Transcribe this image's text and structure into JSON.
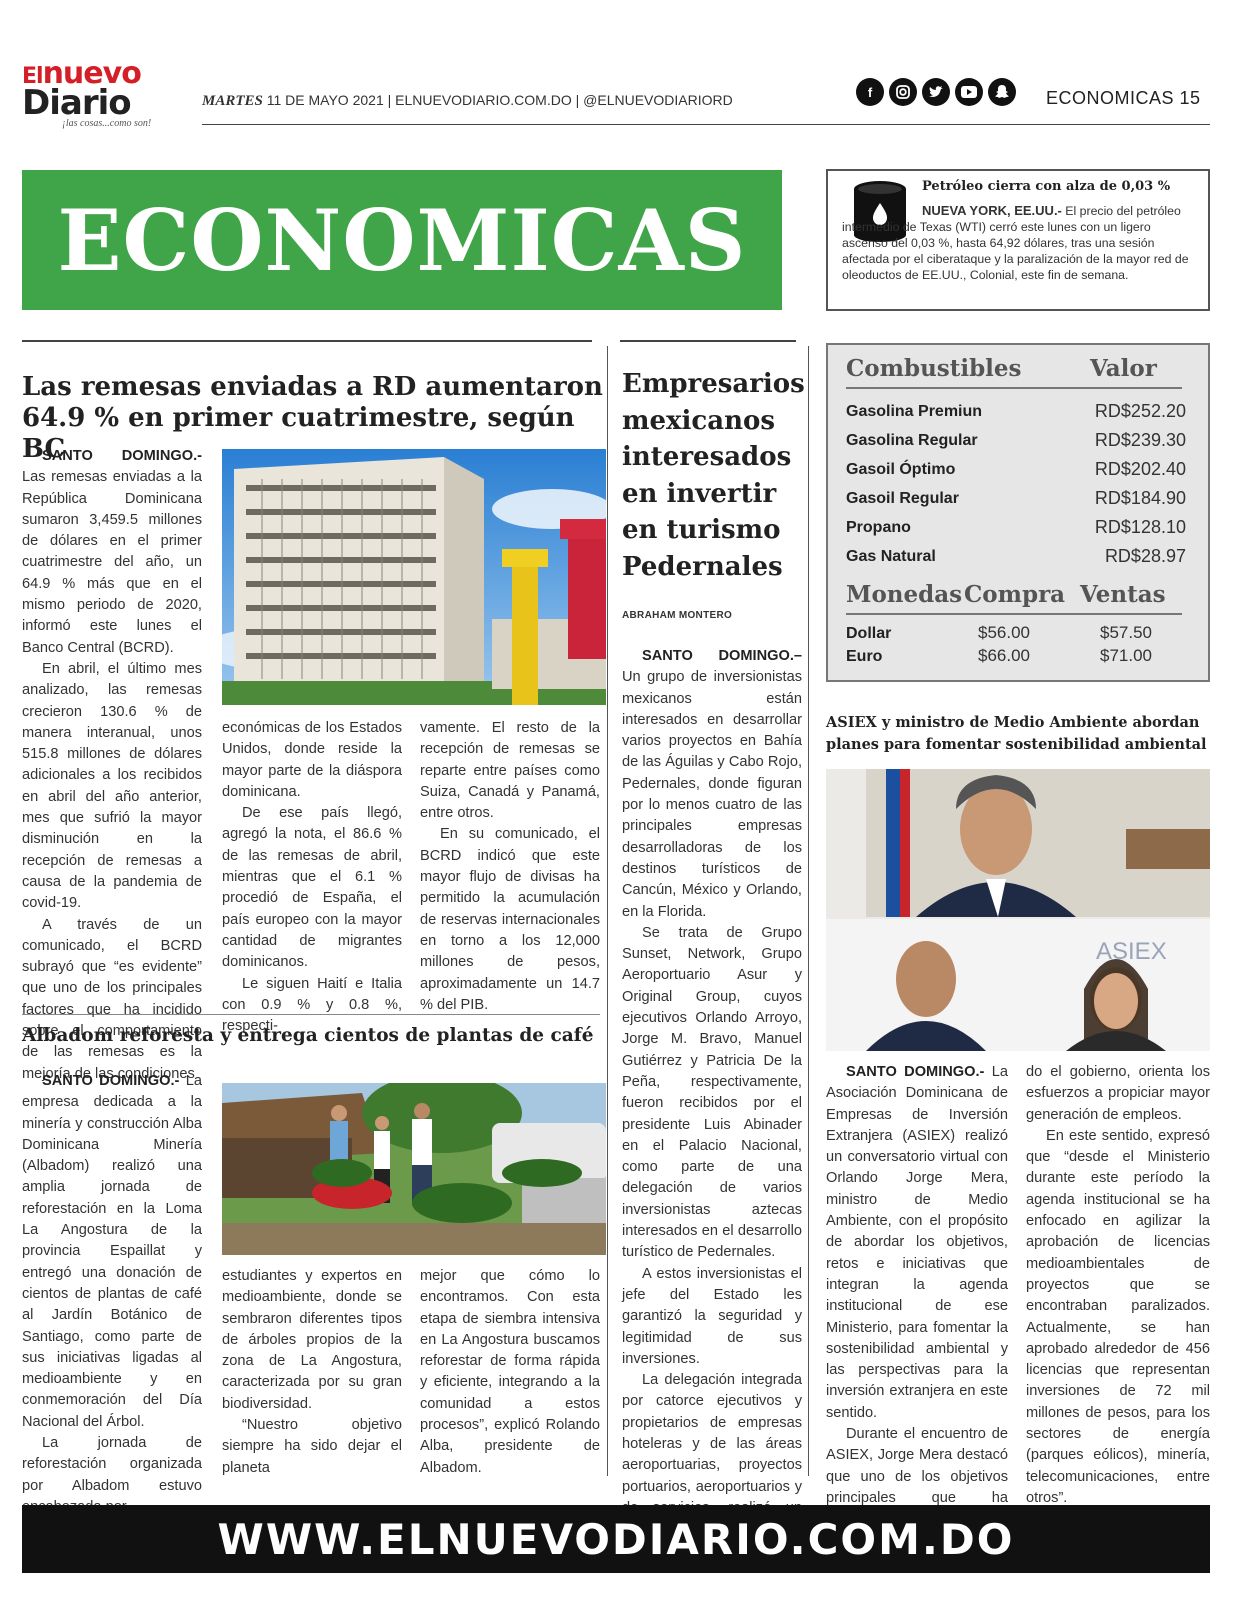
{
  "masthead": {
    "logo_el": "El",
    "logo_nuevo": "nuevo",
    "logo_diario": "Diario",
    "logo_tagline": "¡las cosas...como son!",
    "day": "MARTES",
    "date_rest": " 11 DE MAYO 2021 | ELNUEVODIARIO.COM.DO | @ELNUEVODIARIORD",
    "section_page": "ECONOMICAS 15",
    "social_icons": [
      "facebook-icon",
      "instagram-icon",
      "twitter-icon",
      "youtube-icon",
      "snapchat-icon"
    ]
  },
  "banner": {
    "title": "ECONOMICAS",
    "color": "#3fa548"
  },
  "oil_brief": {
    "title": "Petróleo cierra con alza de 0,03 %",
    "kicker": "NUEVA YORK, EE.UU.-",
    "body": " El precio del petróleo intermedio de Texas (WTI) cerró este lunes con un ligero ascenso del 0,03 %, hasta 64,92 dólares, tras una sesión afectada por el ciberataque y la paralización de la mayor red de oleoductos de EE.UU., Colonial, este fin de semana."
  },
  "remesas": {
    "headline": "Las remesas enviadas a RD aumentaron 64.9 % en primer cuatrimestre, según BC",
    "kicker": "SANTO DOMINGO.-",
    "col1_p1": " Las remesas enviadas a la República Dominicana sumaron 3,459.5 millones de dólares en el primer cuatrimestre del año, un 64.9 % más que en el mismo periodo de 2020, informó este lunes el Banco Central (BCRD).",
    "col1_p2": "En abril, el último mes analizado, las remesas crecieron 130.6 % de manera interanual, unos 515.8 millones de dólares adicionales a los recibidos en abril del año anterior, mes que sufrió la mayor disminución en la recepción de remesas a causa de la pandemia de covid-19.",
    "col1_p3": "A través de un comunicado, el BCRD subrayó que “es evidente” que uno de los principales factores que ha incidido sobre el comportamiento de las remesas es la mejoría de las condiciones",
    "col2_p1": "económicas de los Estados Unidos, donde reside la mayor parte de la diáspora dominicana.",
    "col2_p2": "De ese país llegó, agregó la nota, el 86.6 % de las remesas de abril, mientras que el 6.1 % procedió de España, el país europeo con la mayor cantidad de migrantes dominicanos.",
    "col2_p3": "Le siguen Haití e Italia con 0.9 % y 0.8 %, respecti-",
    "col3_p1": "vamente. El resto de la recepción de remesas se reparte entre países como Suiza, Canadá y Panamá, entre otros.",
    "col3_p2": "En su comunicado, el BCRD indicó que este mayor flujo de divisas ha permitido la acumulación de reservas internacionales en torno a los 12,000 millones de pesos, aproximadamente un 14.7 % del PIB."
  },
  "albadom": {
    "headline": "Albadom reforesta y entrega cientos de plantas de café",
    "kicker": "SANTO DOMINGO.-",
    "col1_p1": " La empresa dedicada a la minería y construcción Alba Dominicana Minería (Albadom) realizó una amplia jornada de reforestación en la Loma La Angostura de la provincia Espaillat y entregó una donación de cientos de plantas de café al Jardín Botánico de Santiago, como parte de sus iniciativas ligadas al medioambiente y en conmemoración del Día Nacional del Árbol.",
    "col1_p2": "La jornada de reforestación organizada por Albadom estuvo encabezada por",
    "col2_p1": "estudiantes y expertos en medioambiente, donde se sembraron diferentes tipos de árboles propios de la zona de La Angostura, caracterizada por su gran biodiversidad.",
    "col2_p2": "“Nuestro objetivo siempre ha sido dejar el planeta",
    "col3_p1": "mejor que cómo lo encontramos. Con esta etapa de siembra intensiva en La Angostura buscamos reforestar de forma rápida y eficiente, integrando a la comunidad a estos procesos”, explicó Rolando Alba, presidente de Albadom."
  },
  "turismo": {
    "headline": "Empresarios mexicanos interesados en invertir en turismo Pedernales",
    "byline": "ABRAHAM MONTERO",
    "kicker": "SANTO DOMINGO.–",
    "p1": " Un grupo de inversionistas mexicanos están interesados en desarrollar varios proyectos en Bahía de las Águilas y Cabo Rojo, Pedernales, donde figuran por lo menos cuatro de las principales empresas desarrolladoras de los destinos turísticos de Cancún, México y Orlando, en la Florida.",
    "p2": "Se trata de Grupo Sunset, Network, Grupo Aeroportuario Asur y Original Group, cuyos ejecutivos Orlando Arroyo, Jorge M. Bravo, Manuel Gutiérrez y Patricia De la Peña, respectivamente, fueron recibidos por el presidente Luis Abinader en el Palacio Nacional, como parte de una delegación de varios inversionistas aztecas interesados en el desarrollo turístico de Pedernales.",
    "p3": "A estos inversionistas el jefe del Estado les garantizó la seguridad y legitimidad de sus inversiones.",
    "p4": "La delegación integrada por catorce ejecutivos y propietarios de empresas hoteleras y de las áreas aeroportuarias, proyectos portuarios, aeroportuarios y de servicios, realizó un recorrido por la zona de Cabo Rojo."
  },
  "fuel_table": {
    "h_name": "Combustibles",
    "h_value": "Valor",
    "rows": [
      {
        "name": "Gasolina Premiun",
        "value": "RD$252.20"
      },
      {
        "name": "Gasolina Regular",
        "value": "RD$239.30"
      },
      {
        "name": "Gasoil Óptimo",
        "value": "RD$202.40"
      },
      {
        "name": "Gasoil Regular",
        "value": "RD$184.90"
      },
      {
        "name": "Propano",
        "value": "RD$128.10"
      },
      {
        "name": "Gas Natural",
        "value": "RD$28.97"
      }
    ],
    "h_currency": "Monedas",
    "h_buy": "Compra",
    "h_sell": "Ventas",
    "currencies": [
      {
        "name": "Dollar",
        "buy": "$56.00",
        "sell": "$57.50"
      },
      {
        "name": "Euro",
        "buy": "$66.00",
        "sell": "$71.00"
      }
    ]
  },
  "asiex": {
    "headline": "ASIEX y ministro de Medio Ambiente abordan planes para fomentar sostenibilidad ambiental",
    "photo_sign": "ASIEX",
    "kicker": "SANTO DOMINGO.-",
    "col1_p1": " La Asociación Dominicana de Empresas de Inversión Extranjera (ASIEX) realizó un conversatorio virtual con Orlando Jorge Mera, ministro de Medio Ambiente, con el propósito de abordar los objetivos, retos e iniciativas que integran la agenda institucional de ese Ministerio, para fomentar la sostenibilidad ambiental y las perspectivas para la inversión extranjera en este sentido.",
    "col1_p2": "Durante el encuentro de ASIEX, Jorge Mera destacó que uno de los objetivos principales que ha estableci-",
    "col2_p1": "do el gobierno, orienta los esfuerzos a propiciar mayor generación de empleos.",
    "col2_p2": "En este sentido, expresó que “desde el Ministerio durante este período la agenda institucional se ha enfocado en agilizar la aprobación de licencias medioambientales de proyectos que se encontraban paralizados. Actualmente, se han aprobado alrededor de 456 licencias que representan inversiones de 72 mil millones de pesos, para los sectores de energía (parques eólicos), minería, telecomunicaciones, entre otros”."
  },
  "footer": {
    "url": "WWW.ELNUEVODIARIO.COM.DO"
  }
}
